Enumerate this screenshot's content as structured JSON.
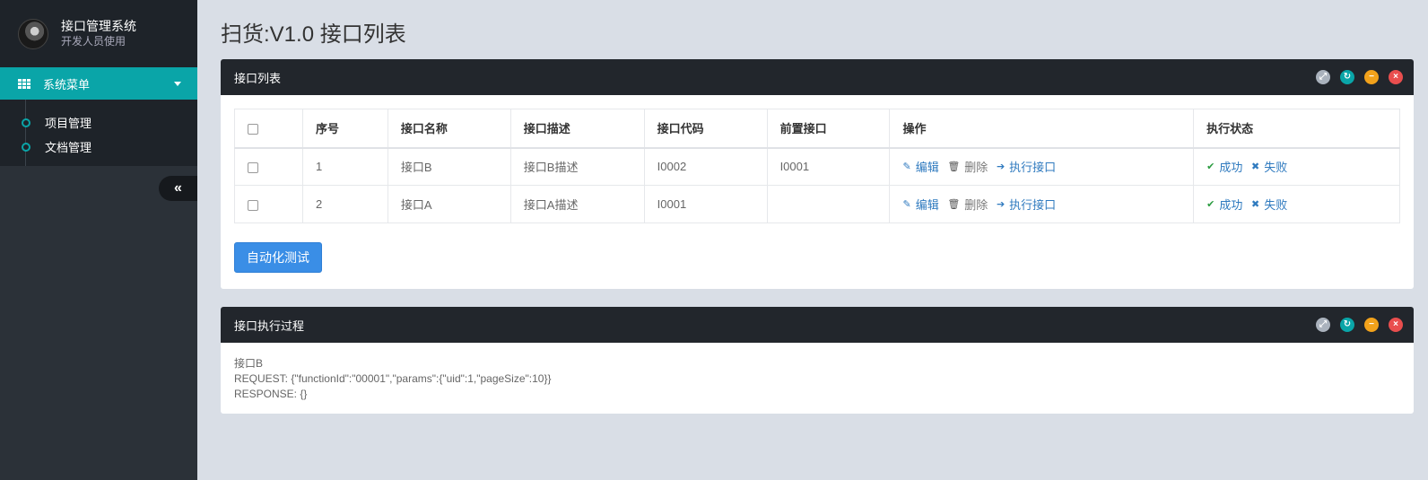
{
  "brand": {
    "title": "接口管理系统",
    "subtitle": "开发人员使用"
  },
  "menu": {
    "head": "系统菜单",
    "items": [
      {
        "label": "项目管理"
      },
      {
        "label": "文档管理"
      }
    ],
    "collapse_glyph": "«"
  },
  "page_title": "扫货:V1.0 接口列表",
  "list_panel": {
    "title": "接口列表",
    "columns": [
      "序号",
      "接口名称",
      "接口描述",
      "接口代码",
      "前置接口",
      "操作",
      "执行状态"
    ],
    "rows": [
      {
        "index": "1",
        "name": "接口B",
        "desc": "接口B描述",
        "code": "I0002",
        "pre": "I0001"
      },
      {
        "index": "2",
        "name": "接口A",
        "desc": "接口A描述",
        "code": "I0001",
        "pre": ""
      }
    ],
    "ops": {
      "edit": "编辑",
      "delete": "删除",
      "execute": "执行接口"
    },
    "status": {
      "success": "成功",
      "fail": "失败"
    },
    "auto_test_button": "自动化测试"
  },
  "process_panel": {
    "title": "接口执行过程",
    "lines": [
      "接口B",
      "REQUEST: {\"functionId\":\"00001\",\"params\":{\"uid\":1,\"pageSize\":10}}",
      "RESPONSE: {}"
    ]
  },
  "icons": {
    "panel_tools": [
      "expand-icon",
      "refresh-icon",
      "minimize-icon",
      "close-icon"
    ],
    "ops": [
      "pencil-icon",
      "trash-icon",
      "arrow-right-icon"
    ],
    "status": [
      "check-icon",
      "x-icon"
    ]
  },
  "colors": {
    "accent": "#0aa5a8",
    "header": "#22262c",
    "sidebar": "#2b3138",
    "button": "#3a8ee6",
    "link": "#2f7abf"
  }
}
